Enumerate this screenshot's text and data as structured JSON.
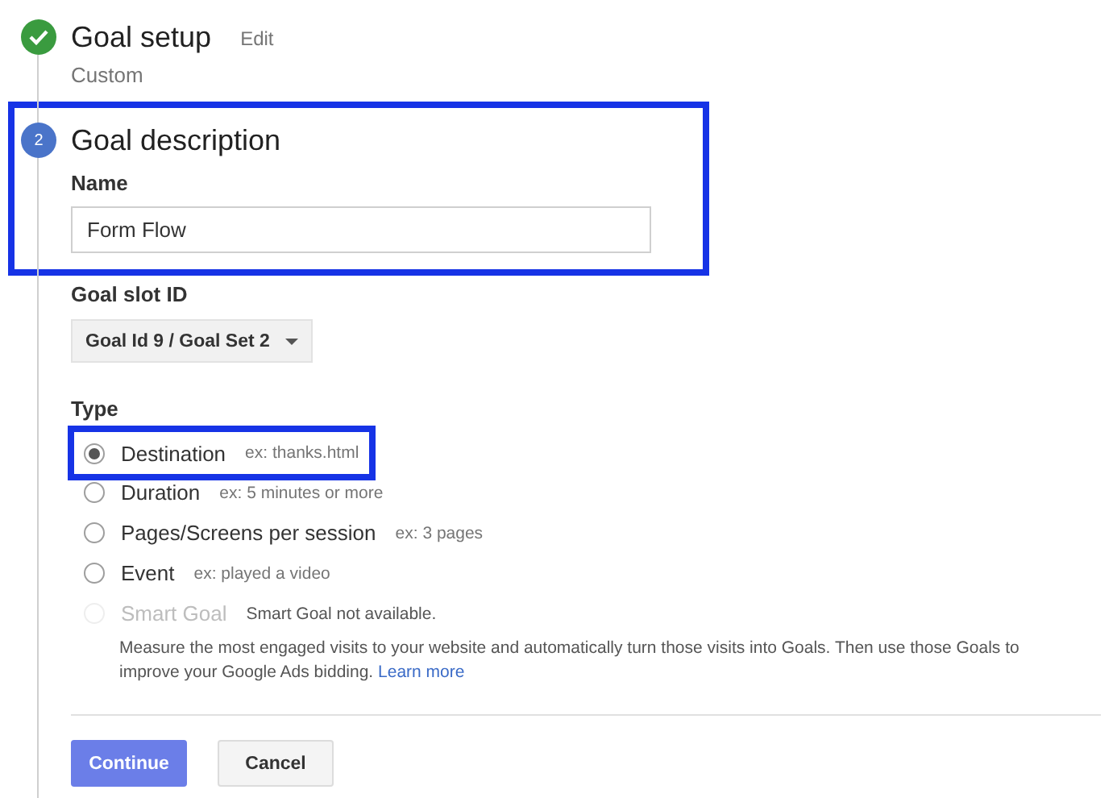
{
  "steps": [
    {
      "title": "Goal setup",
      "completed": true,
      "edit_link": "Edit",
      "summary": "Custom"
    },
    {
      "number": "2",
      "title": "Goal description",
      "completed": false,
      "highlighted": true
    }
  ],
  "name_field": {
    "label": "Name",
    "value": "Form Flow"
  },
  "goal_slot": {
    "label": "Goal slot ID",
    "value": "Goal Id 9 / Goal Set 2"
  },
  "type": {
    "label": "Type",
    "options": [
      {
        "label": "Destination",
        "hint": "ex: thanks.html",
        "selected": true,
        "disabled": false,
        "highlighted": true
      },
      {
        "label": "Duration",
        "hint": "ex: 5 minutes or more",
        "selected": false,
        "disabled": false,
        "highlighted": false
      },
      {
        "label": "Pages/Screens per session",
        "hint": "ex: 3 pages",
        "selected": false,
        "disabled": false,
        "highlighted": false
      },
      {
        "label": "Event",
        "hint": "ex: played a video",
        "selected": false,
        "disabled": false,
        "highlighted": false
      },
      {
        "label": "Smart Goal",
        "hint": "Smart Goal not available.",
        "selected": false,
        "disabled": true,
        "highlighted": false
      }
    ],
    "description": "Measure the most engaged visits to your website and automatically turn those visits into Goals. Then use those Goals to improve your Google Ads bidding.",
    "link": "Learn more"
  },
  "buttons": [
    {
      "label": "Continue",
      "kind": "primary"
    },
    {
      "label": "Cancel",
      "kind": "secondary"
    }
  ]
}
